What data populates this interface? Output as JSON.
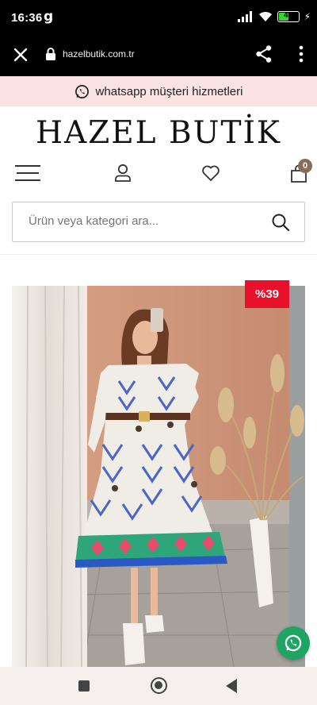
{
  "status_bar": {
    "time": "16:36",
    "carrier_glyph": "g",
    "battery_level": "49",
    "icons": [
      "signal-icon",
      "wifi-icon",
      "battery-icon",
      "charging-bolt-icon"
    ]
  },
  "browser": {
    "url": "hazelbutik.com.tr",
    "icons": [
      "close-icon",
      "lock-icon",
      "share-icon",
      "more-vert-icon"
    ]
  },
  "banner": {
    "label": "whatsapp müşteri hizmetleri",
    "icon": "whatsapp-icon"
  },
  "header": {
    "logo": "HAZEL BUTİK",
    "cart_count": "0",
    "icons": [
      "menu-icon",
      "user-icon",
      "heart-icon",
      "cart-icon"
    ]
  },
  "search": {
    "placeholder": "Ürün veya kategori ara...",
    "icon": "search-icon"
  },
  "product": {
    "discount": "%39",
    "image_subject": "woman in patterned midi dress taking mirror selfie"
  },
  "floating": {
    "icon": "whatsapp-icon"
  },
  "nav": {
    "icons": [
      "recents-icon",
      "home-icon",
      "back-icon"
    ]
  },
  "colors": {
    "banner_bg": "#fbe3e3",
    "discount_bg": "#e8102a",
    "whatsapp_green": "#1fa463",
    "badge": "#8a6a5a"
  }
}
